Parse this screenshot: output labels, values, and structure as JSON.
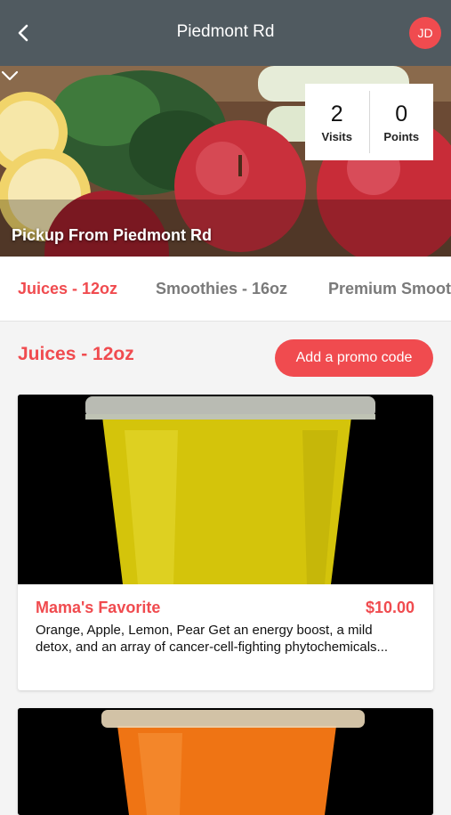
{
  "header": {
    "title": "Piedmont Rd",
    "avatar_initials": "JD"
  },
  "hero": {
    "visits_value": "2",
    "visits_label": "Visits",
    "points_value": "0",
    "points_label": "Points",
    "pickup_text": "Pickup From Piedmont Rd"
  },
  "tabs": [
    {
      "label": "Juices - 12oz",
      "active": true
    },
    {
      "label": "Smoothies - 16oz",
      "active": false
    },
    {
      "label": "Premium Smoothies",
      "active": false
    }
  ],
  "section": {
    "title": "Juices - 12oz",
    "promo_label": "Add a promo code"
  },
  "items": [
    {
      "name": "Mama's Favorite",
      "price": "$10.00",
      "description": "Orange, Apple, Lemon, Pear Get an energy boost, a mild detox, and an array of cancer-cell-fighting phytochemicals..."
    }
  ],
  "colors": {
    "accent": "#f04b4f",
    "header_bg": "#505a60",
    "juice_yellow": "#d6c60c",
    "juice_orange": "#f07a14"
  },
  "icons": {
    "back": "chevron-left-icon",
    "expand": "chevron-down-icon"
  }
}
